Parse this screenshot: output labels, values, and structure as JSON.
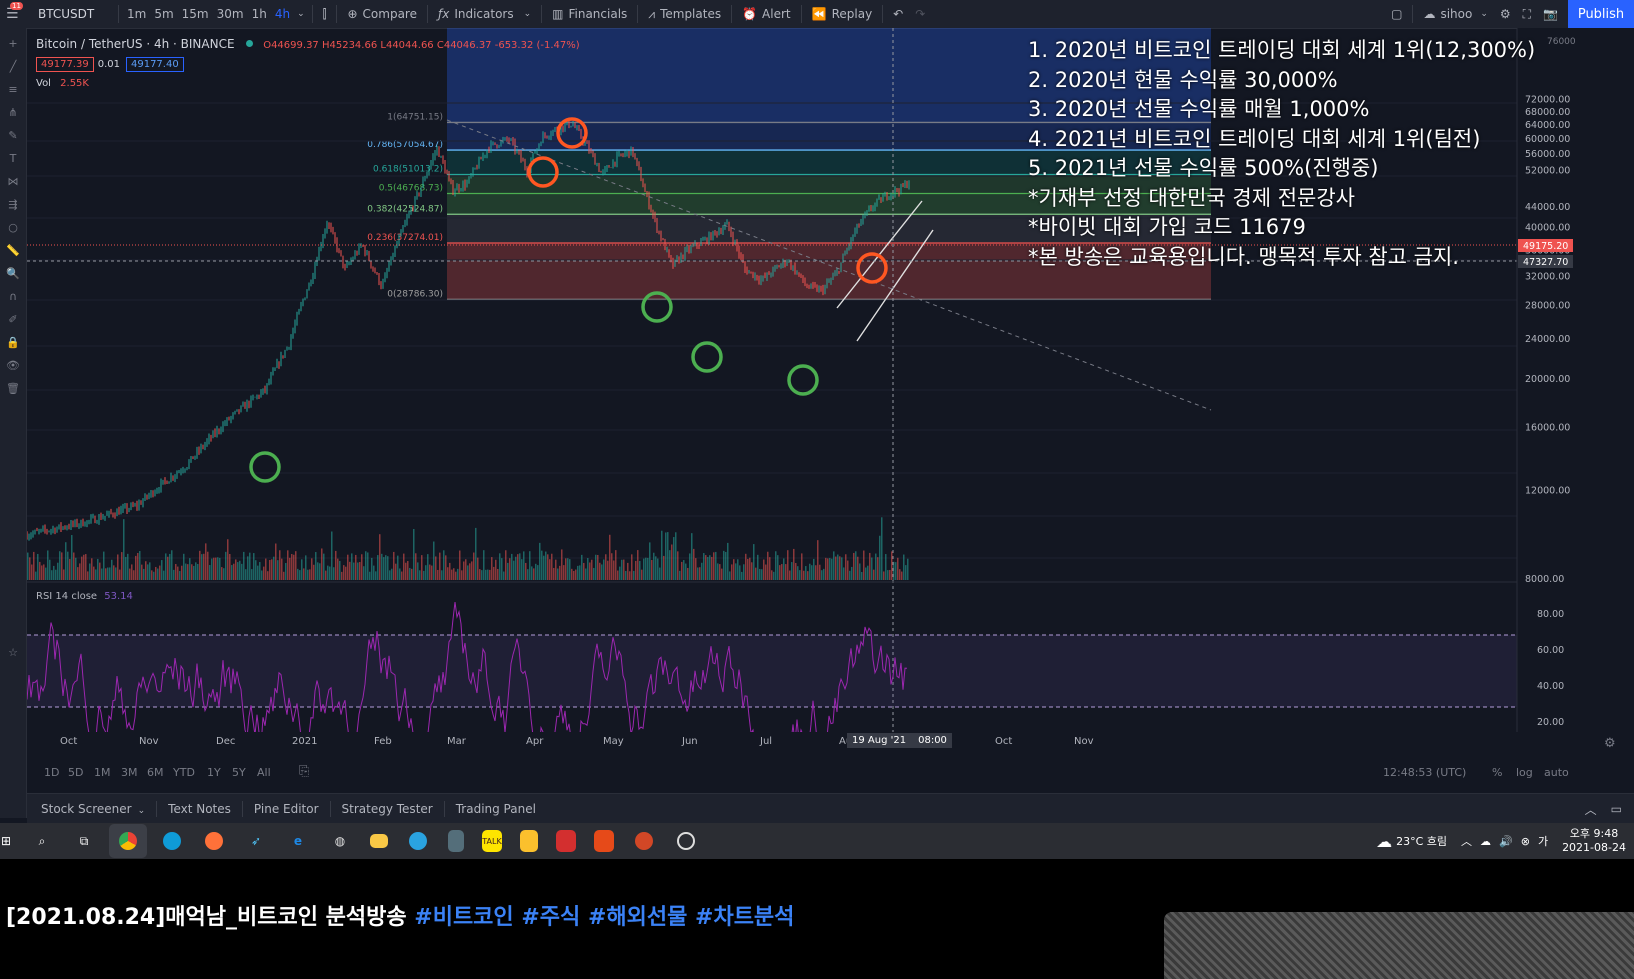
{
  "toolbar": {
    "menu_badge": "11",
    "symbol": "BTCUSDT",
    "intervals": [
      "1m",
      "5m",
      "15m",
      "30m",
      "1h",
      "4h"
    ],
    "active_interval": "4h",
    "compare": "Compare",
    "indicators": "Indicators",
    "financials": "Financials",
    "templates": "Templates",
    "alert": "Alert",
    "replay": "Replay",
    "user": "sihoo",
    "publish": "Publish"
  },
  "legend": {
    "title": "Bitcoin / TetherUS · 4h · BINANCE",
    "ohlc": "O44699.37 H45234.66 L44044.66 C44046.37 -653.32 (-1.47%)",
    "bid": "49177.39",
    "spread": "0.01",
    "ask": "49177.40",
    "volume": "Vol",
    "volume_value": "2.55K",
    "rsi": "RSI 14 close",
    "rsi_value": "53.14"
  },
  "fib": {
    "levels": [
      {
        "label": "1(64751.15)",
        "price": 64751.15
      },
      {
        "label": "0.786(57054.67)",
        "price": 57054.67
      },
      {
        "label": "0.618(51013.2)",
        "price": 51013.2
      },
      {
        "label": "0.5(46768.73)",
        "price": 46768.73
      },
      {
        "label": "0.382(42524.87)",
        "price": 42524.87
      },
      {
        "label": "0.236(37274.01)",
        "price": 37274.01
      },
      {
        "label": "0(28786.30)",
        "price": 28786.3
      }
    ]
  },
  "price_axis": {
    "ticks": [
      "72000.00",
      "68000.00",
      "64000.00",
      "60000.00",
      "56000.00",
      "52000.00",
      "44000.00",
      "40000.00",
      "36000.00",
      "32000.00",
      "28000.00",
      "24000.00",
      "20000.00",
      "16000.00",
      "12000.00",
      "8000.00"
    ],
    "current_price": "49175.20",
    "crosshair_price": "47327.70",
    "top_fragment": "76000"
  },
  "rsi_axis": {
    "ticks": [
      "80.00",
      "60.00",
      "40.00",
      "20.00"
    ]
  },
  "time_axis": {
    "labels": [
      "Oct",
      "Nov",
      "Dec",
      "2021",
      "Feb",
      "Mar",
      "Apr",
      "May",
      "Jun",
      "Jul",
      "Au",
      "Oct",
      "Nov"
    ],
    "crosshair_date": "19 Aug '21",
    "crosshair_time": "08:00"
  },
  "period_bar": {
    "ranges": [
      "1D",
      "5D",
      "1M",
      "3M",
      "6M",
      "YTD",
      "1Y",
      "5Y",
      "All"
    ],
    "clock": "12:48:53 (UTC)",
    "percent": "%",
    "log": "log",
    "auto": "auto"
  },
  "bottom_tabs": [
    "Stock Screener",
    "Text Notes",
    "Pine Editor",
    "Strategy Tester",
    "Trading Panel"
  ],
  "overlay_text": [
    "1. 2020년 비트코인 트레이딩 대회 세계 1위(12,300%)",
    "2. 2020년 현물 수익률 30,000%",
    "3. 2020년 선물 수익률 매월 1,000%",
    "4. 2021년 비트코인 트레이딩 대회 세계 1위(팀전)",
    "5. 2021년 선물 수익률 500%(진행중)",
    "*기재부 선정 대한민국 경제 전문강사",
    "*바이빗 대회 가입 코드 11679",
    "*본 방송은 교육용입니다. 맹목적 투자 참고 금지."
  ],
  "taskbar": {
    "weather": "23°C 흐림",
    "time": "오후 9:48",
    "date": "2021-08-24"
  },
  "caption": {
    "title": "[2021.08.24]매억남_비트코인 분석방송",
    "tags": [
      "#비트코인",
      "#주식",
      "#해외선물",
      "#차트분석"
    ]
  },
  "colors": {
    "background": "#131722",
    "up": "#26a69a",
    "down": "#ef5350",
    "rsi": "#9c27b0",
    "accent": "#2962ff"
  }
}
